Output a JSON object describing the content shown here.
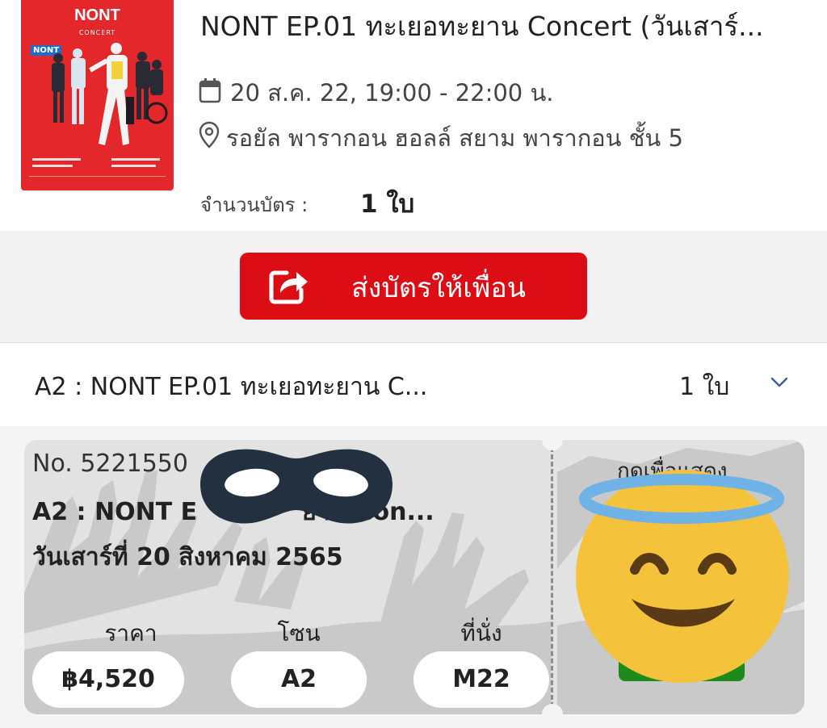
{
  "event": {
    "poster_brand": "NONT",
    "poster_sub": "CONCERT",
    "poster_tag": "NONT",
    "title": "NONT EP.01 ทะเยอทะยาน Concert (วันเสาร์...",
    "date_time": "20 ส.ค. 22, 19:00 - 22:00 น.",
    "venue": "รอยัล พารากอน ฮอลล์ สยาม พารากอน ชั้น 5",
    "quantity_label": "จำนวนบัตร :",
    "quantity_value": "1 ใบ",
    "icons": {
      "date": "calendar-icon",
      "venue": "location-pin-icon"
    }
  },
  "actions": {
    "send_ticket_label": "ส่งบัตรให้เพื่อน",
    "send_ticket_icon": "share-icon",
    "accent_color": "#dd0d15"
  },
  "ticket_section": {
    "title": "A2 : NONT EP.01 ทะเยอทะยาน C...",
    "count": "1 ใบ",
    "toggle_icon": "chevron-down-icon"
  },
  "ticket": {
    "number": "No. 5221550",
    "title": "A2 : NONT E",
    "title_end": "ยาน Con...",
    "date": "วันเสาร์ที่ 20 สิงหาคม 2565",
    "price_label": "ราคา",
    "price_value": "฿4,520",
    "zone_label": "โซน",
    "zone_value": "A2",
    "seat_label": "ที่นั่ง",
    "seat_value": "M22",
    "reveal_hint": "กดเพื่อแสดง",
    "overlay_icons": [
      "mask-emoji-icon",
      "smiling-face-with-halo-icon"
    ]
  }
}
